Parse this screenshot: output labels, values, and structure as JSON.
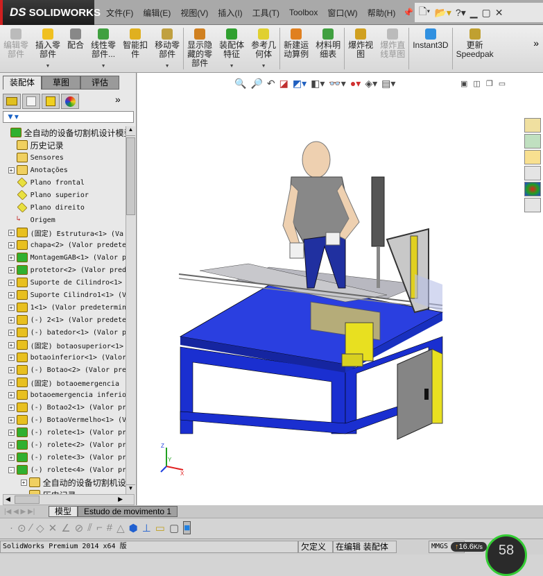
{
  "app": {
    "logo": "SOLIDWORKS",
    "logo_prefix": "DS"
  },
  "menu": [
    "文件(F)",
    "编辑(E)",
    "视图(V)",
    "插入(I)",
    "工具(T)",
    "Toolbox",
    "窗口(W)",
    "帮助(H)"
  ],
  "toolbar": [
    {
      "label": "编辑零\n部件",
      "disabled": true,
      "color": "#bbbbbb"
    },
    {
      "label": "插入零\n部件",
      "dropdown": true,
      "color": "#f0c020"
    },
    {
      "label": "配合",
      "color": "#888888"
    },
    {
      "label": "线性零\n部件...",
      "dropdown": true,
      "color": "#40a040"
    },
    {
      "label": "智能扣\n件",
      "color": "#e0b020"
    },
    {
      "label": "移动零\n部件",
      "dropdown": true,
      "color": "#c0a040"
    },
    {
      "label": "显示隐\n藏的零\n部件",
      "color": "#d08020"
    },
    {
      "label": "装配体\n特征",
      "dropdown": true,
      "color": "#30a030"
    },
    {
      "label": "参考几\n何体",
      "dropdown": true,
      "color": "#e0d030"
    },
    {
      "label": "新建运\n动算例",
      "color": "#e08020"
    },
    {
      "label": "材料明\n细表",
      "color": "#40a040"
    },
    {
      "label": "爆炸视\n图",
      "color": "#d0a020"
    },
    {
      "label": "爆炸直\n线草图",
      "disabled": true,
      "color": "#bbbbbb"
    },
    {
      "label": "Instant3D",
      "color": "#3090e0"
    },
    {
      "label": "更新\nSpeedpak",
      "color": "#c0a030"
    }
  ],
  "left_panel": {
    "tabs": [
      "装配体",
      "草图",
      "评估"
    ],
    "tree_root": "全自动的设备切割机设计模型",
    "tree": [
      {
        "label": "历史记录",
        "type": "history",
        "cjk": true
      },
      {
        "label": "Sensores",
        "type": "sensor"
      },
      {
        "label": "Anotações",
        "type": "annot",
        "expand": "+"
      },
      {
        "label": "Plano frontal",
        "type": "plane"
      },
      {
        "label": "Plano superior",
        "type": "plane"
      },
      {
        "label": "Plano direito",
        "type": "plane"
      },
      {
        "label": "Origem",
        "type": "origin"
      },
      {
        "label": "(固定) Estrutura<1> (Va",
        "type": "part",
        "expand": "+"
      },
      {
        "label": "chapa<2> (Valor predete",
        "type": "part",
        "expand": "+"
      },
      {
        "label": "MontagemGAB<1> (Valor p",
        "type": "asm",
        "expand": "+"
      },
      {
        "label": "protetor<2> (Valor pred",
        "type": "asm",
        "expand": "+"
      },
      {
        "label": "Suporte de Cilindro<1>",
        "type": "part",
        "expand": "+"
      },
      {
        "label": "Suporte Cilindro1<1> (V",
        "type": "part",
        "expand": "+"
      },
      {
        "label": "1<1> (Valor predetermin",
        "type": "part",
        "expand": "+"
      },
      {
        "label": "(-) 2<1> (Valor predete",
        "type": "part",
        "expand": "+"
      },
      {
        "label": "(-) batedor<1> (Valor p",
        "type": "part",
        "expand": "+"
      },
      {
        "label": "(固定) botaosuperior<1>",
        "type": "part",
        "expand": "+"
      },
      {
        "label": "botaoinferior<1> (Valor",
        "type": "part",
        "expand": "+"
      },
      {
        "label": "(-) Botao<2> (Valor pre",
        "type": "part",
        "expand": "+"
      },
      {
        "label": "(固定) botaoemergencia",
        "type": "part",
        "expand": "+"
      },
      {
        "label": "botaoemergencia inferio",
        "type": "part",
        "expand": "+"
      },
      {
        "label": "(-) Botao2<1> (Valor pr",
        "type": "part",
        "expand": "+"
      },
      {
        "label": "(-) BotaoVermelho<1> (V",
        "type": "part",
        "expand": "+"
      },
      {
        "label": "(-) rolete<1> (Valor pr",
        "type": "asm",
        "expand": "+"
      },
      {
        "label": "(-) rolete<2> (Valor pr",
        "type": "asm",
        "expand": "+"
      },
      {
        "label": "(-) rolete<3> (Valor pr",
        "type": "asm",
        "expand": "+"
      },
      {
        "label": "(-) rolete<4> (Valor pr",
        "type": "asm",
        "expand": "-"
      },
      {
        "label": "全自动的设备切割机设",
        "type": "folder",
        "expand": "+",
        "indent": 1,
        "cjk": true
      },
      {
        "label": "历史记录",
        "type": "history",
        "indent": 1,
        "cjk": true
      }
    ]
  },
  "bottom_tabs": [
    "模型",
    "Estudo de movimento 1"
  ],
  "status": {
    "product": "SolidWorks Premium 2014 x64 版",
    "state": "欠定义",
    "mode": "在编辑 装配体",
    "units": "MMGS",
    "speed": "16.6",
    "speed_unit": "K/s",
    "gauge": "58"
  },
  "colors": {
    "accent": "#d02020",
    "table_blue": "#1a2fd0",
    "part_yellow": "#e8e020"
  }
}
